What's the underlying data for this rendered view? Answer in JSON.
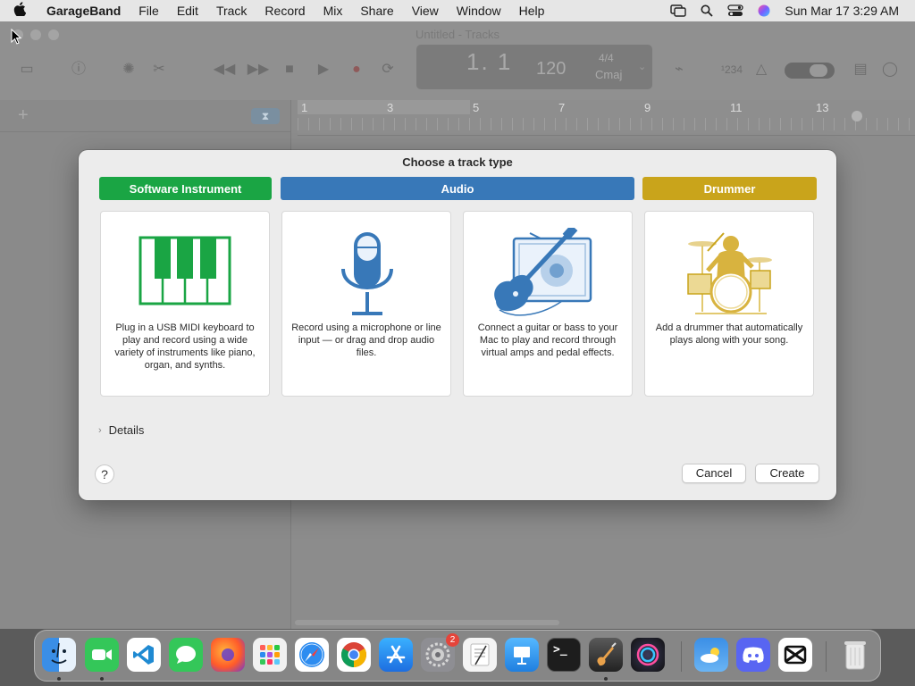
{
  "menubar": {
    "app_name": "GarageBand",
    "items": [
      "File",
      "Edit",
      "Track",
      "Record",
      "Mix",
      "Share",
      "View",
      "Window",
      "Help"
    ],
    "clock": "Sun Mar 17  3:29 AM"
  },
  "window": {
    "title": "Untitled - Tracks",
    "lcd": {
      "bar_beat": "1. 1",
      "tempo": "120",
      "time_signature": "4/4",
      "key": "Cmaj"
    },
    "count_in": "¹234",
    "ruler_numbers": [
      "1",
      "3",
      "5",
      "7",
      "9",
      "11",
      "13"
    ]
  },
  "dialog": {
    "title": "Choose a track type",
    "categories": [
      {
        "label": "Software Instrument",
        "color": "#1aa544"
      },
      {
        "label": "Audio",
        "color": "#3878b8"
      },
      {
        "label": "Drummer",
        "color": "#c9a41b"
      }
    ],
    "cards": [
      {
        "description": "Plug in a USB MIDI keyboard to play and record using a wide variety of instruments like piano, organ, and synths.",
        "icon": "piano-keyboard-icon",
        "color": "#1aa544"
      },
      {
        "description": "Record using a microphone or line input — or drag and drop audio files.",
        "icon": "microphone-icon",
        "color": "#3878b8"
      },
      {
        "description": "Connect a guitar or bass to your Mac to play and record through virtual amps and pedal effects.",
        "icon": "guitar-amp-icon",
        "color": "#3878b8"
      },
      {
        "description": "Add a drummer that automatically plays along with your song.",
        "icon": "drummer-icon",
        "color": "#c9a41b"
      }
    ],
    "details_label": "Details",
    "help_label": "?",
    "cancel_label": "Cancel",
    "create_label": "Create"
  },
  "dock": {
    "apps": [
      {
        "name": "Finder",
        "icon": "finder-icon",
        "color": "#3a8ee6",
        "running": true
      },
      {
        "name": "FaceTime",
        "icon": "facetime-icon",
        "color": "#34c759",
        "running": true
      },
      {
        "name": "Visual Studio Code",
        "icon": "vscode-icon",
        "color": "#ffffff",
        "running": false
      },
      {
        "name": "Messages",
        "icon": "messages-icon",
        "color": "#34c759",
        "running": false
      },
      {
        "name": "Firefox",
        "icon": "firefox-icon",
        "color": "#6f3ad1",
        "running": false
      },
      {
        "name": "Launchpad",
        "icon": "launchpad-icon",
        "color": "#f1f1f1",
        "running": false
      },
      {
        "name": "Safari",
        "icon": "safari-icon",
        "color": "#2d8cf0",
        "running": false
      },
      {
        "name": "Chrome",
        "icon": "chrome-icon",
        "color": "#ffffff",
        "running": false
      },
      {
        "name": "App Store",
        "icon": "app-store-icon",
        "color": "#1d8ff2",
        "running": false
      },
      {
        "name": "System Settings",
        "icon": "settings-icon",
        "color": "#8e8e93",
        "running": false,
        "badge": "2"
      },
      {
        "name": "TextEdit",
        "icon": "textedit-icon",
        "color": "#f4f4f4",
        "running": false
      },
      {
        "name": "Keynote",
        "icon": "keynote-icon",
        "color": "#2f9bf0",
        "running": false
      },
      {
        "name": "Terminal",
        "icon": "terminal-icon",
        "color": "#1d1d1d",
        "running": false
      },
      {
        "name": "GarageBand",
        "icon": "garageband-icon",
        "color": "#3a3a3a",
        "running": true
      },
      {
        "name": "Siri",
        "icon": "siri-icon",
        "color": "#2a2a3a",
        "running": false
      },
      {
        "name": "Weather",
        "icon": "weather-icon",
        "color": "#3b8fe6",
        "running": false
      },
      {
        "name": "Discord",
        "icon": "discord-icon",
        "color": "#5865f2",
        "running": false
      },
      {
        "name": "CapCut",
        "icon": "capcut-icon",
        "color": "#ffffff",
        "running": false
      },
      {
        "name": "Trash",
        "icon": "trash-icon",
        "color": "#e9e9e9",
        "running": false
      }
    ]
  }
}
